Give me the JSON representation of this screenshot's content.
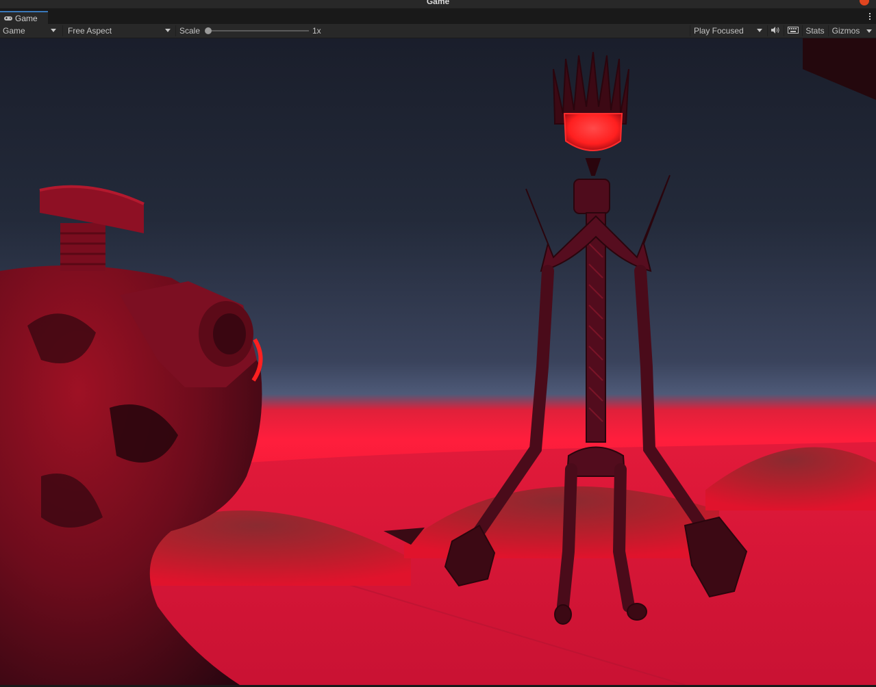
{
  "window": {
    "title": "Game"
  },
  "tabs": [
    {
      "label": "Game",
      "icon": "gamepad-icon"
    }
  ],
  "toolbar": {
    "display_dropdown": "Game",
    "aspect_dropdown": "Free Aspect",
    "scale_label": "Scale",
    "scale_value": "1x",
    "scale_level": 0,
    "play_mode_dropdown": "Play Focused",
    "mute_icon": "speaker-icon",
    "keyboard_icon": "keyboard-icon",
    "stats_label": "Stats",
    "gizmos_label": "Gizmos"
  },
  "colors": {
    "editor_bg": "#282828",
    "tab_accent": "#3a79bb",
    "sky_top": "#1d2230",
    "sky_horizon": "#4e5a78",
    "horizon_glow": "#ff1e3c",
    "ground": "#d81436",
    "figure_dark": "#4a0b1a",
    "eye_glow": "#ff2828",
    "close_dot": "#e0451f"
  }
}
